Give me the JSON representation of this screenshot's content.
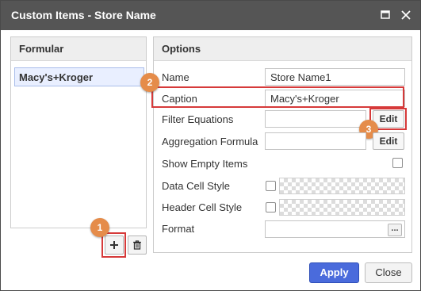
{
  "window": {
    "title": "Custom Items - Store Name",
    "maximize_icon": "maximize-icon",
    "close_icon": "close-icon"
  },
  "left_panel": {
    "header": "Formular",
    "items": [
      {
        "label": "Macy's+Kroger",
        "selected": true
      }
    ],
    "add_icon": "plus-icon",
    "delete_icon": "trash-icon"
  },
  "options": {
    "header": "Options",
    "name_label": "Name",
    "name_value": "Store Name1",
    "caption_label": "Caption",
    "caption_value": "Macy's+Kroger",
    "filter_label": "Filter Equations",
    "filter_value": "",
    "filter_edit": "Edit",
    "aggregation_label": "Aggregation Formula",
    "aggregation_value": "",
    "aggregation_edit": "Edit",
    "show_empty_label": "Show Empty Items",
    "show_empty_checked": false,
    "data_cell_label": "Data Cell Style",
    "data_cell_checked": false,
    "header_cell_label": "Header Cell Style",
    "header_cell_checked": false,
    "format_label": "Format",
    "format_value": "",
    "format_button": "..."
  },
  "footer": {
    "apply": "Apply",
    "close": "Close"
  },
  "annotations": {
    "badge1": "1",
    "badge2": "2",
    "badge3": "3",
    "highlight_color": "#d63a3a",
    "badge_color": "#e58c4a"
  },
  "colors": {
    "titlebar": "#555555",
    "apply_button": "#4a6bdc",
    "selected_item_bg": "#e9efff"
  }
}
